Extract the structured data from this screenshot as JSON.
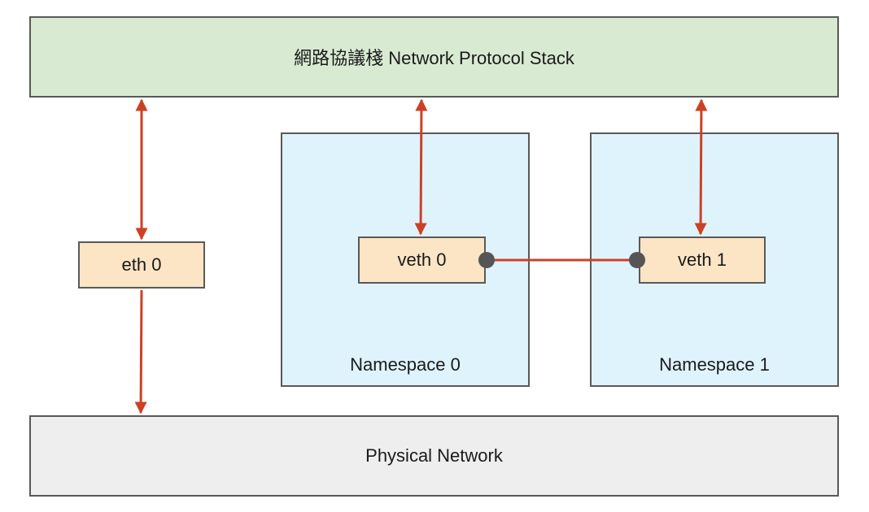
{
  "diagram": {
    "stack_label": "網路協議棧 Network Protocol Stack",
    "physical_label": "Physical Network",
    "namespaces": [
      {
        "label": "Namespace 0"
      },
      {
        "label": "Namespace 1"
      }
    ],
    "interfaces": {
      "eth0": "eth 0",
      "veth0": "veth 0",
      "veth1": "veth 1"
    }
  },
  "colors": {
    "stack_fill": "#d9ead3",
    "physical_fill": "#eeeeee",
    "namespace_fill": "#dff3fd",
    "interface_fill": "#fce5c5",
    "border": "#595959",
    "arrow": "#cc4125",
    "connector_dot": "#555555"
  }
}
